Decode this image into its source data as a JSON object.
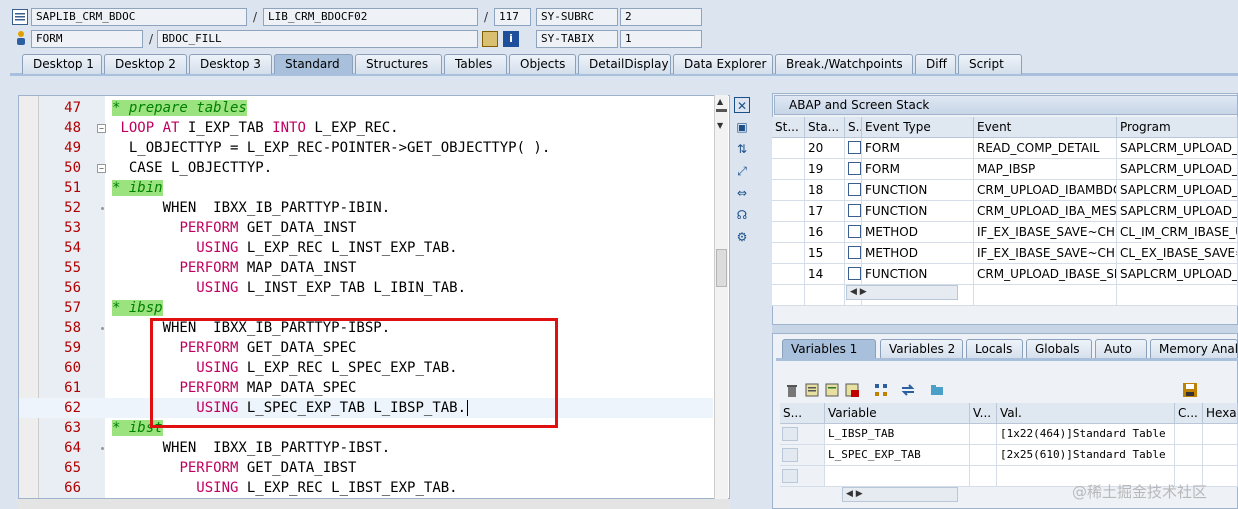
{
  "header": {
    "row1": {
      "program": "SAPLIB_CRM_BDOC",
      "include": "LIB_CRM_BDOCF02",
      "line": "117",
      "sysfield_label": "SY-SUBRC",
      "sysfield_value": "2"
    },
    "row2": {
      "event_type": "FORM",
      "event_name": "BDOC_FILL",
      "sysfield_label": "SY-TABIX",
      "sysfield_value": "1"
    },
    "sep1": "/",
    "sep2": "/",
    "sep3": "/"
  },
  "tabs": [
    "Desktop 1",
    "Desktop 2",
    "Desktop 3",
    "Standard",
    "Structures",
    "Tables",
    "Objects",
    "DetailDisplay",
    "Data Explorer",
    "Break./Watchpoints",
    "Diff",
    "Script"
  ],
  "active_tab": "Standard",
  "code": [
    {
      "n": "47",
      "parts": [
        [
          "cm",
          "* prepare tables"
        ]
      ]
    },
    {
      "n": "48",
      "fold": true,
      "parts": [
        [
          "",
          " "
        ],
        [
          "kw2",
          "LOOP AT"
        ],
        [
          "",
          " I_EXP_TAB "
        ],
        [
          "kw2",
          "INTO"
        ],
        [
          "",
          " L_EXP_REC."
        ]
      ]
    },
    {
      "n": "49",
      "parts": [
        [
          "",
          "  L_OBJECTTYP = L_EXP_REC-POINTER->GET_OBJECTTYP( )."
        ]
      ]
    },
    {
      "n": "50",
      "fold": true,
      "parts": [
        [
          "",
          "  CASE L_OBJECTTYP."
        ]
      ]
    },
    {
      "n": "51",
      "parts": [
        [
          "cm",
          "* ibin"
        ]
      ]
    },
    {
      "n": "52",
      "dot": true,
      "parts": [
        [
          "",
          "      WHEN  IBXX_IB_PARTTYP-IBIN."
        ]
      ]
    },
    {
      "n": "53",
      "parts": [
        [
          "",
          "        "
        ],
        [
          "kw2",
          "PERFORM"
        ],
        [
          "",
          " GET_DATA_INST"
        ]
      ]
    },
    {
      "n": "54",
      "parts": [
        [
          "",
          "          "
        ],
        [
          "kw2",
          "USING"
        ],
        [
          "",
          " L_EXP_REC L_INST_EXP_TAB."
        ]
      ]
    },
    {
      "n": "55",
      "parts": [
        [
          "",
          "        "
        ],
        [
          "kw2",
          "PERFORM"
        ],
        [
          "",
          " MAP_DATA_INST"
        ]
      ]
    },
    {
      "n": "56",
      "parts": [
        [
          "",
          "          "
        ],
        [
          "kw2",
          "USING"
        ],
        [
          "",
          " L_INST_EXP_TAB L_IBIN_TAB."
        ]
      ]
    },
    {
      "n": "57",
      "parts": [
        [
          "cm",
          "* ibsp"
        ]
      ]
    },
    {
      "n": "58",
      "dot": true,
      "parts": [
        [
          "",
          "      WHEN  IBXX_IB_PARTTYP-IBSP."
        ]
      ]
    },
    {
      "n": "59",
      "parts": [
        [
          "",
          "        "
        ],
        [
          "kw2",
          "PERFORM"
        ],
        [
          "",
          " GET_DATA_SPEC"
        ]
      ]
    },
    {
      "n": "60",
      "parts": [
        [
          "",
          "          "
        ],
        [
          "kw2",
          "USING"
        ],
        [
          "",
          " L_EXP_REC L_SPEC_EXP_TAB."
        ]
      ]
    },
    {
      "n": "61",
      "parts": [
        [
          "",
          "        "
        ],
        [
          "kw2",
          "PERFORM"
        ],
        [
          "",
          " MAP_DATA_SPEC"
        ]
      ]
    },
    {
      "n": "62",
      "sel": true,
      "parts": [
        [
          "",
          "          "
        ],
        [
          "kw2",
          "USING"
        ],
        [
          "",
          " L_SPEC_EXP_TAB L_IBSP_TAB."
        ]
      ]
    },
    {
      "n": "63",
      "parts": [
        [
          "cm",
          "* ibst"
        ]
      ]
    },
    {
      "n": "64",
      "dot": true,
      "parts": [
        [
          "",
          "      WHEN  IBXX_IB_PARTTYP-IBST."
        ]
      ]
    },
    {
      "n": "65",
      "parts": [
        [
          "",
          "        "
        ],
        [
          "kw2",
          "PERFORM"
        ],
        [
          "",
          " GET_DATA_IBST"
        ]
      ]
    },
    {
      "n": "66",
      "parts": [
        [
          "",
          "          "
        ],
        [
          "kw2",
          "USING"
        ],
        [
          "",
          " L_EXP_REC L_IBST_EXP_TAB."
        ]
      ]
    }
  ],
  "stack": {
    "title": "ABAP and Screen Stack",
    "columns": [
      "St...",
      "Sta...",
      "S..",
      "Event Type",
      "Event",
      "Program"
    ],
    "rows": [
      {
        "sta": "20",
        "type": "FORM",
        "event": "READ_COMP_DETAIL",
        "program": "SAPLCRM_UPLOAD_IB"
      },
      {
        "sta": "19",
        "type": "FORM",
        "event": "MAP_IBSP",
        "program": "SAPLCRM_UPLOAD_IB"
      },
      {
        "sta": "18",
        "type": "FUNCTION",
        "event": "CRM_UPLOAD_IBAMBDO...",
        "program": "SAPLCRM_UPLOAD_IB"
      },
      {
        "sta": "17",
        "type": "FUNCTION",
        "event": "CRM_UPLOAD_IBA_MES...",
        "program": "SAPLCRM_UPLOAD_IB"
      },
      {
        "sta": "16",
        "type": "METHOD",
        "event": "IF_EX_IBASE_SAVE~CH...",
        "program": "CL_IM_CRM_IBASE_U"
      },
      {
        "sta": "15",
        "type": "METHOD",
        "event": "IF_EX_IBASE_SAVE~CH...",
        "program": "CL_EX_IBASE_SAVE="
      },
      {
        "sta": "14",
        "type": "FUNCTION",
        "event": "CRM_UPLOAD_IBASE_SI...",
        "program": "SAPLCRM_UPLOAD_IB"
      }
    ]
  },
  "var_tabs": [
    "Variables 1",
    "Variables 2",
    "Locals",
    "Globals",
    "Auto",
    "Memory Analys"
  ],
  "variables": {
    "columns": [
      "S...",
      "Variable",
      "V...",
      "Val.",
      "C...",
      "Hexad"
    ],
    "rows": [
      {
        "name": "L_IBSP_TAB",
        "value": "[1x22(464)]Standard Table"
      },
      {
        "name": "L_SPEC_EXP_TAB",
        "value": "[2x25(610)]Standard Table"
      }
    ]
  },
  "watermark": "@稀土掘金技术社区",
  "colors": {
    "accent": "#a9c0dc",
    "highlight_box": "#e11010",
    "comment_bg": "#9be37f",
    "keyword": "#c00060"
  }
}
